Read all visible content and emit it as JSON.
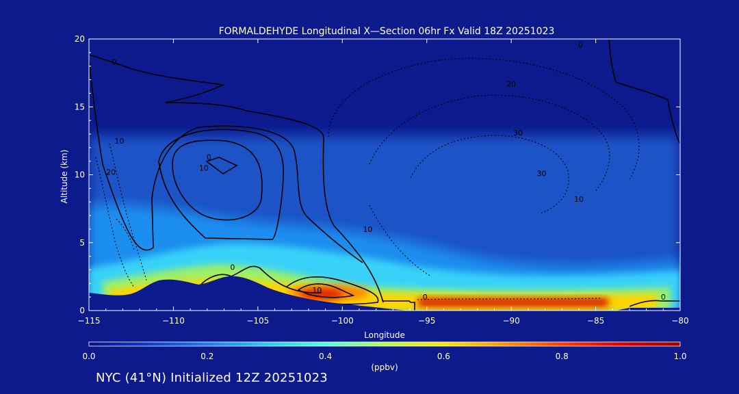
{
  "chart_data": {
    "type": "heatmap",
    "title": "FORMALDEHYDE Longitudinal X—Section 06hr  Fx Valid 18Z 20251023",
    "xlabel": "Longitude",
    "ylabel": "Altitude (km)",
    "xlim": [
      -115,
      -80
    ],
    "ylim": [
      0,
      20
    ],
    "x_ticks": [
      -115,
      -110,
      -105,
      -100,
      -95,
      -90,
      -85,
      -80
    ],
    "x_tick_labels": [
      "−115",
      "−110",
      "−105",
      "−100",
      "−95",
      "−90",
      "−85",
      "−80"
    ],
    "y_ticks": [
      0,
      5,
      10,
      15,
      20
    ],
    "y_tick_labels": [
      "0",
      "5",
      "10",
      "15",
      "20"
    ],
    "colorbar": {
      "label": "(ppbv)",
      "range": [
        0.0,
        1.0
      ],
      "ticks": [
        0.0,
        0.2,
        0.4,
        0.6,
        0.8,
        1.0
      ],
      "tick_labels": [
        "0.0",
        "0.2",
        "0.4",
        "0.6",
        "0.8",
        "1.0"
      ],
      "colors": [
        "#0a0f8c",
        "#0a3cc8",
        "#1e78ff",
        "#28c8ff",
        "#50ffe0",
        "#b4ff50",
        "#ffe600",
        "#ff9600",
        "#ff3c00",
        "#dc0000",
        "#a00000"
      ]
    },
    "contour_labels": [
      {
        "text": "0",
        "x": -113.5,
        "y": 18.1
      },
      {
        "text": "0",
        "x": -107.9,
        "y": 11.1
      },
      {
        "text": "0",
        "x": -106.5,
        "y": 3.0
      },
      {
        "text": "0",
        "x": -95.1,
        "y": 0.8
      },
      {
        "text": "0",
        "x": -85.9,
        "y": 19.4
      },
      {
        "text": "0",
        "x": -81.0,
        "y": 0.8
      },
      {
        "text": "10",
        "x": -113.2,
        "y": 12.3
      },
      {
        "text": "10",
        "x": -108.2,
        "y": 10.3
      },
      {
        "text": "10",
        "x": -101.5,
        "y": 1.3
      },
      {
        "text": "10",
        "x": -98.5,
        "y": 5.8
      },
      {
        "text": "10",
        "x": -86.0,
        "y": 8.0
      },
      {
        "text": "20",
        "x": -113.7,
        "y": 10.0
      },
      {
        "text": "20",
        "x": -90.0,
        "y": 16.5
      },
      {
        "text": "30",
        "x": -89.6,
        "y": 12.9
      },
      {
        "text": "30",
        "x": -88.2,
        "y": 9.9
      }
    ]
  },
  "footer": {
    "text": "NYC (41°N) Initialized 12Z 20251023"
  },
  "colors": {
    "background": "#0d1a8c",
    "text": "#ffffff",
    "contour": "#000000"
  }
}
